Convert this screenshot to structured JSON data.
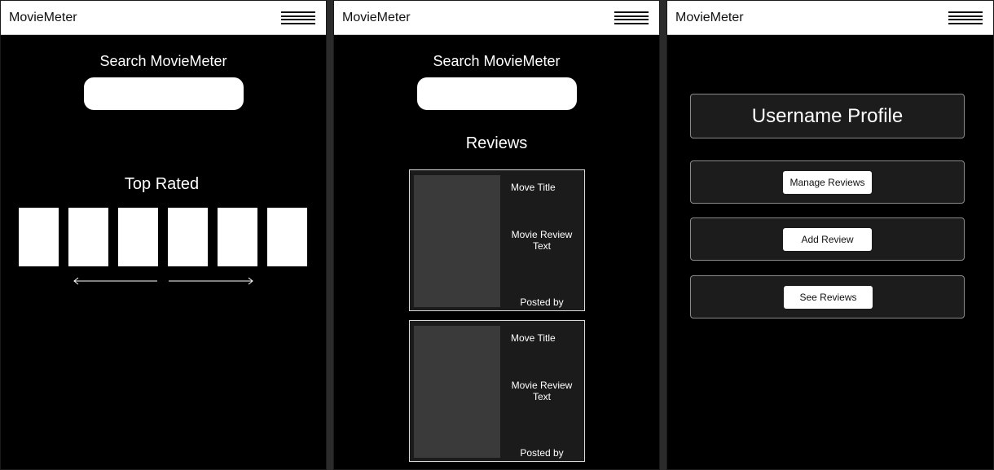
{
  "app": {
    "brand": "MovieMeter"
  },
  "home": {
    "search_title": "Search MovieMeter",
    "search_placeholder": "",
    "top_rated_title": "Top Rated",
    "posters": [
      "",
      "",
      "",
      "",
      "",
      ""
    ]
  },
  "reviews_screen": {
    "search_title": "Search MovieMeter",
    "search_placeholder": "",
    "section_title": "Reviews",
    "cards": [
      {
        "title": "Move Title",
        "text": "Movie Review Text",
        "posted": "Posted by"
      },
      {
        "title": "Move Title",
        "text": "Movie Review Text",
        "posted": "Posted by"
      }
    ]
  },
  "profile_screen": {
    "profile_title": "Username Profile",
    "actions": {
      "manage": "Manage Reviews",
      "add": "Add Review",
      "see": "See Reviews"
    }
  },
  "icons": {
    "menu": "hamburger-menu-icon",
    "left": "arrow-left-icon",
    "right": "arrow-right-icon"
  }
}
